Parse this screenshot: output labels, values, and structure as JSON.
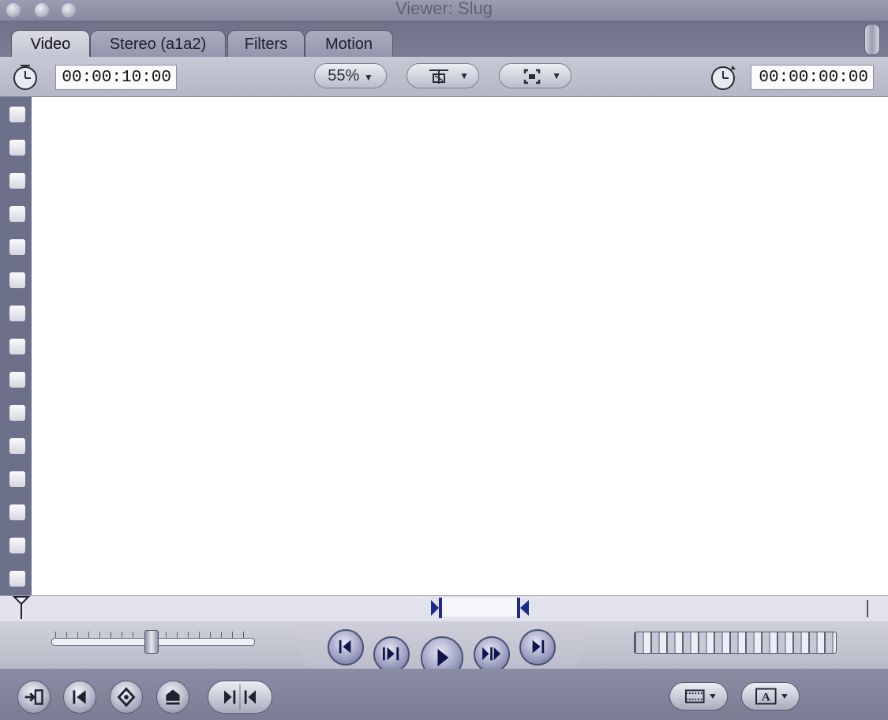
{
  "window": {
    "title": "Viewer: Slug"
  },
  "tabs": [
    {
      "label": "Video",
      "active": true
    },
    {
      "label": "Stereo (a1a2)",
      "active": false
    },
    {
      "label": "Filters",
      "active": false
    },
    {
      "label": "Motion",
      "active": false
    }
  ],
  "toolbar": {
    "duration": "00:00:10:00",
    "current_timecode": "00:00:00:00",
    "zoom_label": "55%",
    "icons": [
      "duration-clock-icon",
      "overlay-icon",
      "view-icon",
      "timecode-clock-icon"
    ]
  },
  "colors": {
    "chrome": "#7f8299",
    "toolbar": "#c7c8d5",
    "canvas": "#ffffff",
    "transport_button": "#9fa3c3"
  },
  "transport": {
    "icons": [
      "go-to-previous-edit-icon",
      "play-in-to-out-icon",
      "play-icon",
      "play-around-current-icon",
      "go-to-next-edit-icon"
    ]
  },
  "bottom_controls": {
    "icons": [
      "insert-edit-icon",
      "mark-in-icon",
      "add-marker-icon",
      "mark-out-icon",
      "match-frame-icon",
      "recent-clips-icon",
      "generator-icon"
    ]
  }
}
